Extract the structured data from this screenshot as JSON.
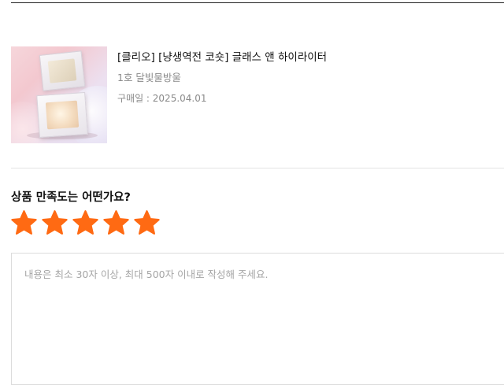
{
  "product": {
    "name": "[클리오] [냥생역전 코숏] 글래스 앤 하이라이터",
    "option": "1호 달빛물방울",
    "purchase_date": "구매일 : 2025.04.01"
  },
  "rating": {
    "question": "상품 만족도는 어떤가요?",
    "value": 5,
    "max": 5,
    "star_color": "#ff6a13"
  },
  "review": {
    "placeholder": "내용은 최소 30자 이상, 최대 500자 이내로 작성해 주세요.",
    "value": ""
  }
}
